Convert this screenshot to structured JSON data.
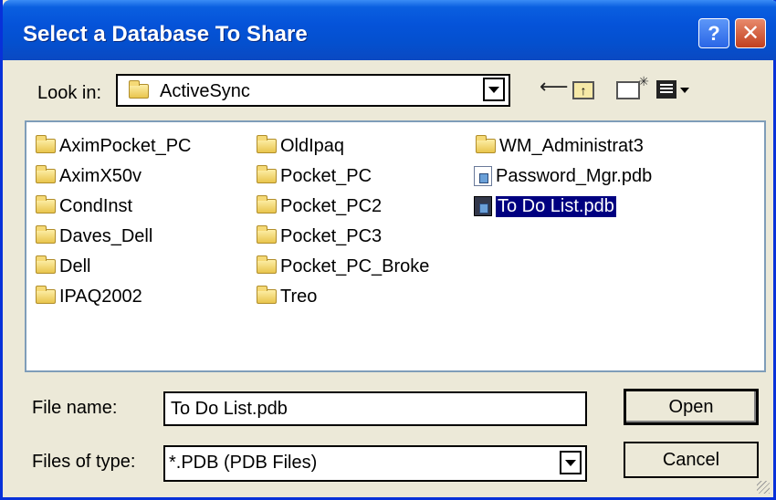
{
  "window": {
    "title": "Select a Database To Share",
    "help_label": "?",
    "close_label": "✕"
  },
  "toolbar": {
    "look_in_label": "Look in:",
    "look_in_value": "ActiveSync",
    "icons": [
      "back-icon",
      "up-folder-icon",
      "new-folder-icon",
      "views-menu-icon"
    ]
  },
  "files": {
    "column1": [
      "AximPocket_PC",
      "AximX50v",
      "CondInst",
      "Daves_Dell",
      "Dell",
      "IPAQ2002"
    ],
    "column2": [
      "OldIpaq",
      "Pocket_PC",
      "Pocket_PC2",
      "Pocket_PC3",
      "Pocket_PC_Broke",
      "Treo"
    ],
    "column3": [
      {
        "name": "WM_Administrat3",
        "icon": "folder-icon"
      },
      {
        "name": "Password_Mgr.pdb",
        "icon": "pdb-file-icon"
      },
      {
        "name": "To Do List.pdb",
        "icon": "pdb-file-icon",
        "selected": true
      }
    ]
  },
  "form": {
    "file_name_label": "File name:",
    "file_name_value": "To Do List.pdb",
    "file_type_label": "Files of type:",
    "file_type_value": "*.PDB (PDB Files)",
    "open_label": "Open",
    "cancel_label": "Cancel"
  },
  "colors": {
    "titlebar": "#0553d9",
    "selection": "#000080",
    "dialog_bg": "#ece9d8"
  }
}
